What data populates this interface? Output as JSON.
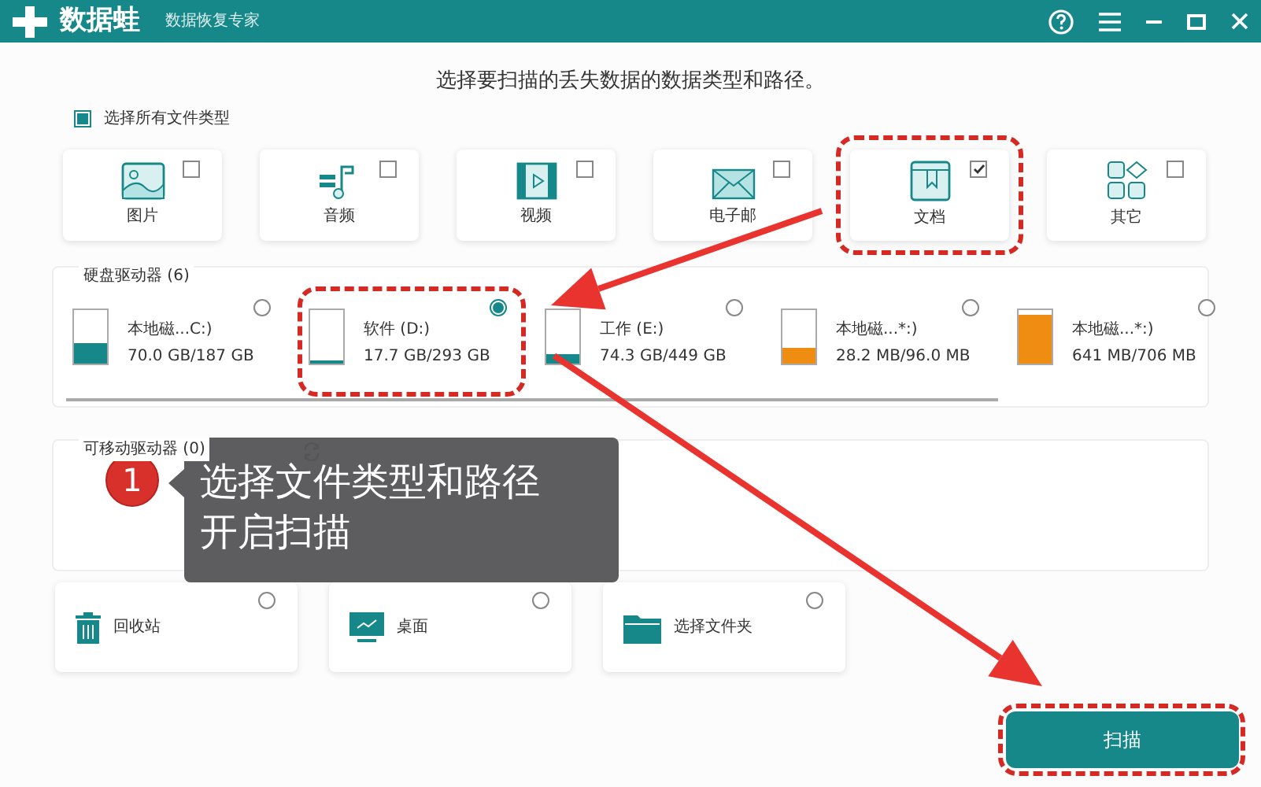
{
  "window": {
    "logo_text": "数据蛙",
    "subtitle": "数据恢复专家"
  },
  "heading": "选择要扫描的丢失数据的数据类型和路径。",
  "select_all": {
    "label": "选择所有文件类型",
    "checked": true
  },
  "file_types": [
    {
      "label": "图片",
      "kind": "image",
      "checked": false,
      "highlighted": false
    },
    {
      "label": "音频",
      "kind": "audio",
      "checked": false,
      "highlighted": false
    },
    {
      "label": "视频",
      "kind": "video",
      "checked": false,
      "highlighted": false
    },
    {
      "label": "电子邮",
      "kind": "email",
      "checked": false,
      "highlighted": false
    },
    {
      "label": "文档",
      "kind": "document",
      "checked": true,
      "highlighted": true
    },
    {
      "label": "其它",
      "kind": "other",
      "checked": false,
      "highlighted": false
    }
  ],
  "hard_drives": {
    "title": "硬盘驱动器 (6)",
    "drives": [
      {
        "name": "本地磁...C:)",
        "usage": "70.0 GB/187 GB",
        "level": 0.37,
        "color": "#17888a",
        "selected": false,
        "highlighted": false
      },
      {
        "name": "软件 (D:)",
        "usage": "17.7 GB/293 GB",
        "level": 0.06,
        "color": "#17888a",
        "selected": true,
        "highlighted": true
      },
      {
        "name": "工作 (E:)",
        "usage": "74.3 GB/449 GB",
        "level": 0.17,
        "color": "#17888a",
        "selected": false,
        "highlighted": false
      },
      {
        "name": "本地磁...*:)",
        "usage": "28.2 MB/96.0 MB",
        "level": 0.29,
        "color": "#ef8c12",
        "selected": false,
        "highlighted": false
      },
      {
        "name": "本地磁...*:)",
        "usage": "641 MB/706 MB",
        "level": 0.91,
        "color": "#ef8c12",
        "selected": false,
        "highlighted": false
      }
    ]
  },
  "removable_drives": {
    "title": "可移动驱动器 (0)"
  },
  "locations": [
    {
      "label": "回收站",
      "kind": "trash",
      "selected": false
    },
    {
      "label": "桌面",
      "kind": "desktop",
      "selected": false
    },
    {
      "label": "选择文件夹",
      "kind": "folder",
      "selected": false
    }
  ],
  "scan_button": {
    "label": "扫描",
    "highlighted": true
  },
  "callout": {
    "badge": "1",
    "lines": [
      "选择文件类型和路径",
      "开启扫描"
    ]
  }
}
